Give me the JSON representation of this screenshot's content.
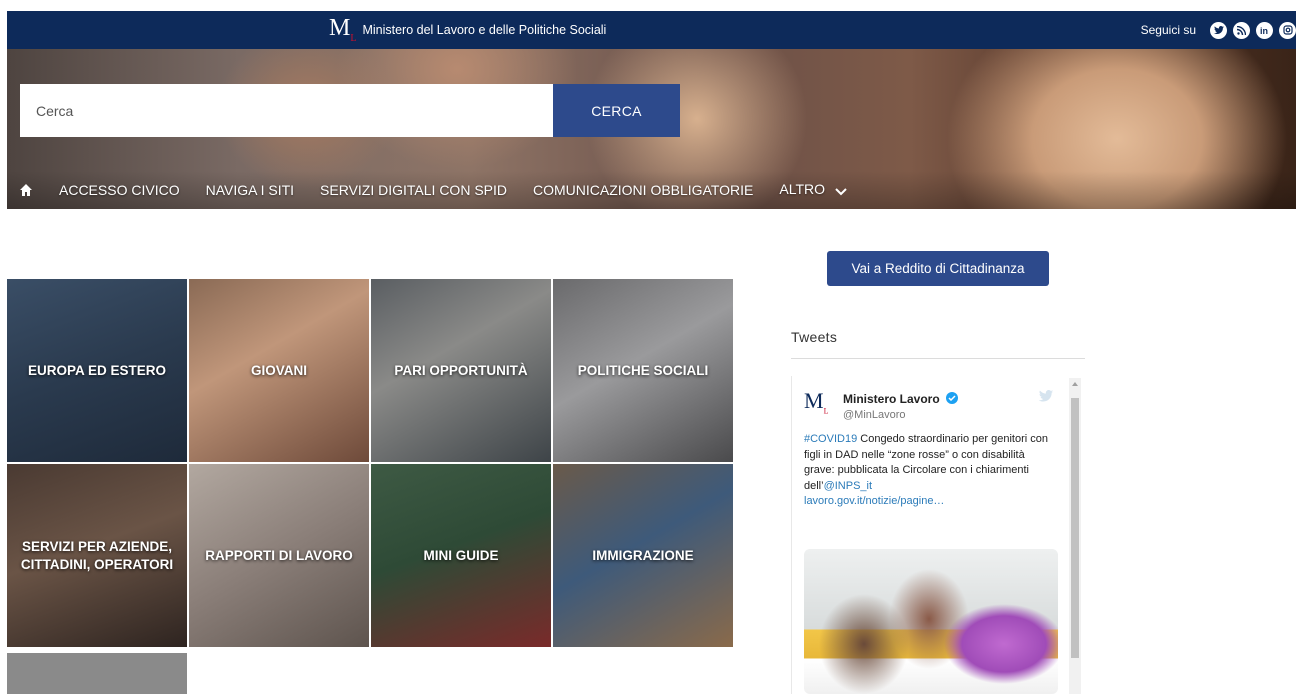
{
  "topbar": {
    "logo_letter": "M",
    "logo_sub": "L",
    "title": "Ministero del Lavoro e delle Politiche Sociali",
    "follow_label": "Seguici su",
    "social_icons": [
      "twitter-icon",
      "rss-icon",
      "linkedin-icon",
      "instagram-icon"
    ]
  },
  "search": {
    "placeholder": "Cerca",
    "button_label": "CERCA"
  },
  "nav": {
    "items": [
      "ACCESSO CIVICO",
      "NAVIGA I SITI",
      "SERVIZI DIGITALI CON SPID",
      "COMUNICAZIONI OBBLIGATORIE"
    ],
    "more_label": "ALTRO"
  },
  "tiles": [
    {
      "label": "EUROPA ED ESTERO"
    },
    {
      "label": "GIOVANI"
    },
    {
      "label": "PARI OPPORTUNITÀ"
    },
    {
      "label": "POLITICHE SOCIALI"
    },
    {
      "label": "SERVIZI PER AZIENDE, CITTADINI, OPERATORI"
    },
    {
      "label": "RAPPORTI DI LAVORO"
    },
    {
      "label": "MINI GUIDE"
    },
    {
      "label": "IMMIGRAZIONE"
    }
  ],
  "sidebar": {
    "rdc_button": "Vai a Reddito di Cittadinanza",
    "tweets_title": "Tweets"
  },
  "tweet": {
    "author": "Ministero Lavoro",
    "handle": "@MinLavoro",
    "hashtag": "#COVID19",
    "text_1": " Congedo straordinario per genitori con figli in DAD nelle “zone rosse” o con disabilità grave: pubblicata la Circolare con i chiarimenti dell’",
    "mention": "@INPS_it",
    "link": "lavoro.gov.it/notizie/pagine…"
  },
  "colors": {
    "topbar": "#0d2a5a",
    "accent": "#2d4a8c",
    "twitter": "#1da1f2",
    "link": "#2b7bb9"
  }
}
